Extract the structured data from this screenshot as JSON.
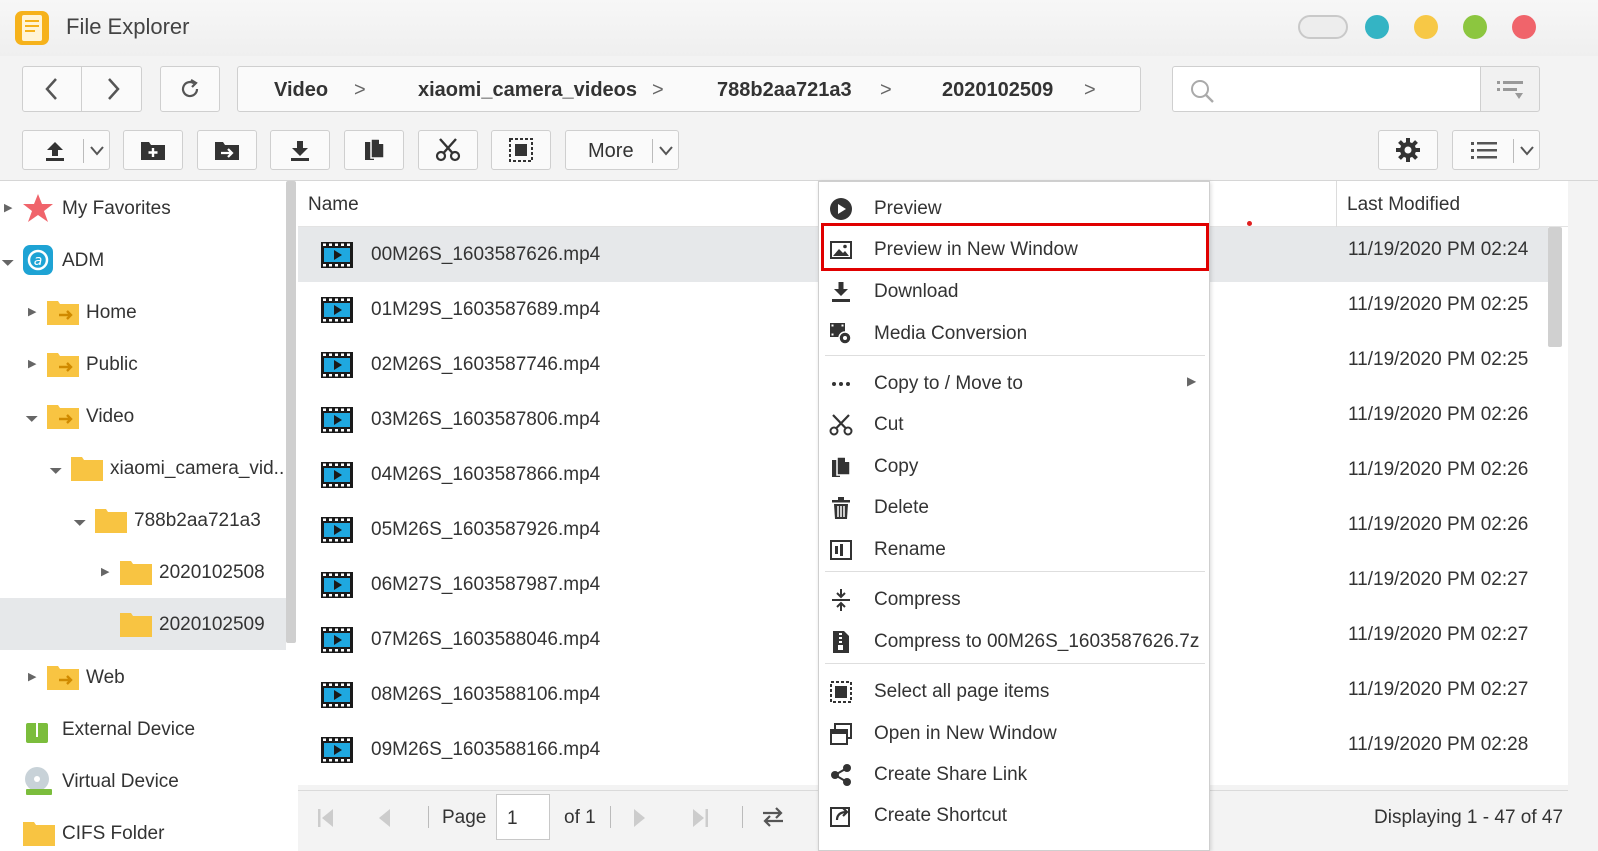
{
  "window": {
    "title": "File Explorer",
    "controls_colors": [
      "#34b4c4",
      "#f7c846",
      "#8cc63f",
      "#f0646b"
    ]
  },
  "breadcrumb": [
    "Video",
    "xiaomi_camera_videos",
    "788b2aa721a3",
    "2020102509"
  ],
  "toolbar": {
    "more_label": "More"
  },
  "tree": {
    "items": [
      {
        "label": "My Favorites",
        "icon": "star-icon"
      },
      {
        "label": "ADM",
        "icon": "adm-icon"
      },
      {
        "label": "Home",
        "icon": "shared-folder-icon"
      },
      {
        "label": "Public",
        "icon": "shared-folder-icon"
      },
      {
        "label": "Video",
        "icon": "shared-folder-icon"
      },
      {
        "label": "xiaomi_camera_vid...",
        "icon": "folder-icon"
      },
      {
        "label": "788b2aa721a3",
        "icon": "folder-icon"
      },
      {
        "label": "2020102508",
        "icon": "folder-icon"
      },
      {
        "label": "2020102509",
        "icon": "folder-icon"
      },
      {
        "label": "Web",
        "icon": "shared-folder-icon"
      },
      {
        "label": "External Device",
        "icon": "usb-icon"
      },
      {
        "label": "Virtual Device",
        "icon": "disc-icon"
      },
      {
        "label": "CIFS Folder",
        "icon": "folder-icon"
      }
    ]
  },
  "filelist": {
    "columns": {
      "name": "Name",
      "modified": "Last Modified"
    },
    "rows": [
      {
        "name": "00M26S_1603587626.mp4",
        "modified": "11/19/2020 PM 02:24"
      },
      {
        "name": "01M29S_1603587689.mp4",
        "modified": "11/19/2020 PM 02:25"
      },
      {
        "name": "02M26S_1603587746.mp4",
        "modified": "11/19/2020 PM 02:25"
      },
      {
        "name": "03M26S_1603587806.mp4",
        "modified": "11/19/2020 PM 02:26"
      },
      {
        "name": "04M26S_1603587866.mp4",
        "modified": "11/19/2020 PM 02:26"
      },
      {
        "name": "05M26S_1603587926.mp4",
        "modified": "11/19/2020 PM 02:26"
      },
      {
        "name": "06M27S_1603587987.mp4",
        "modified": "11/19/2020 PM 02:27"
      },
      {
        "name": "07M26S_1603588046.mp4",
        "modified": "11/19/2020 PM 02:27"
      },
      {
        "name": "08M26S_1603588106.mp4",
        "modified": "11/19/2020 PM 02:27"
      },
      {
        "name": "09M26S_1603588166.mp4",
        "modified": "11/19/2020 PM 02:28"
      }
    ]
  },
  "pager": {
    "page_label": "Page",
    "page_value": "1",
    "of_label": "of 1",
    "displaying": "Displaying 1 - 47 of 47"
  },
  "context_menu": {
    "items": [
      {
        "label": "Preview",
        "icon": "play-circle-icon"
      },
      {
        "label": "Preview in New Window",
        "icon": "image-icon"
      },
      {
        "label": "Download",
        "icon": "download-icon"
      },
      {
        "label": "Media Conversion",
        "icon": "media-conversion-icon"
      },
      {
        "label": "Copy to / Move to",
        "icon": "more-dots-icon"
      },
      {
        "label": "Cut",
        "icon": "scissors-icon"
      },
      {
        "label": "Copy",
        "icon": "copy-icon"
      },
      {
        "label": "Delete",
        "icon": "trash-icon"
      },
      {
        "label": "Rename",
        "icon": "rename-icon"
      },
      {
        "label": "Compress",
        "icon": "compress-icon"
      },
      {
        "label": "Compress to 00M26S_1603587626.7z",
        "icon": "zip-file-icon"
      },
      {
        "label": "Select all page items",
        "icon": "select-all-icon"
      },
      {
        "label": "Open in New Window",
        "icon": "new-window-icon"
      },
      {
        "label": "Create Share Link",
        "icon": "share-icon"
      },
      {
        "label": "Create Shortcut",
        "icon": "shortcut-icon"
      }
    ],
    "highlight_color": "#e00000"
  }
}
